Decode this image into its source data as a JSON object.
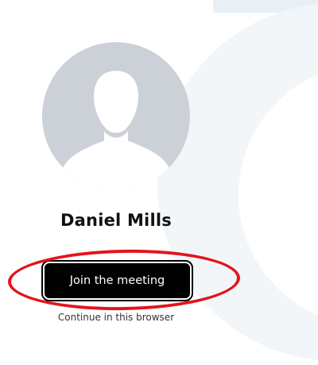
{
  "profile": {
    "name": "Daniel Mills",
    "avatar_icon": "user-silhouette-icon"
  },
  "actions": {
    "join_label": "Join the meeting",
    "continue_label": "Continue in this browser"
  },
  "annotation": {
    "color": "#e3141c"
  },
  "colors": {
    "button_bg": "#000000",
    "button_text": "#ffffff",
    "avatar_bg": "#ccd1d7",
    "avatar_figure": "#ffffff"
  }
}
